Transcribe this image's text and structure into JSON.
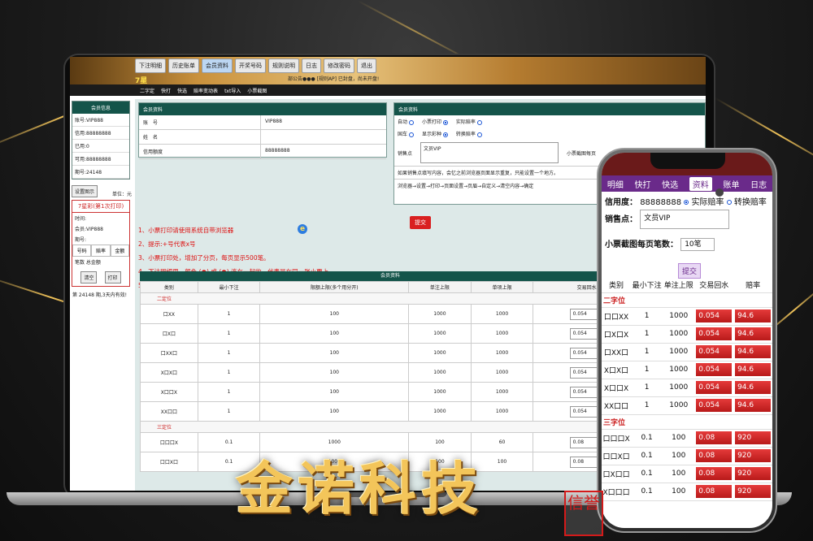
{
  "desktop": {
    "tabs": [
      "下注明细",
      "历史账单",
      "会员资料",
      "开奖号码",
      "规则说明",
      "日志",
      "修改密码",
      "退出"
    ],
    "active_tab": 2,
    "brand_mini": "7星",
    "notice": "部公告●●● [规则AP]       已封盘，尚未开盘!",
    "subnav": [
      "二字定",
      "快打",
      "快选",
      "赔率变动表",
      "txt导入",
      "小票截图"
    ],
    "left": {
      "info_title": "会员信息",
      "rows": [
        "账号:VIP888",
        "信用:88888888",
        "已用:0",
        "可用:88888888",
        "期号:24148"
      ],
      "settings_btn": "设置图示",
      "unit": "单位：元",
      "print_title": "7星彩(第1次打印)",
      "time_label": "时间:",
      "member": "会员:VIP888",
      "period": "期号:",
      "cols": [
        "号码",
        "赔率",
        "金额"
      ],
      "count": "笔数  总金额",
      "clear_btn": "清空",
      "print_btn": "打印",
      "valid": "第 24148 期,3天内有效!"
    },
    "member_card": {
      "title": "会员资料",
      "rows": [
        {
          "k": "账　号",
          "v": "VIP888"
        },
        {
          "k": "姓　名",
          "v": ""
        },
        {
          "k": "信用额度",
          "v": "88888888"
        }
      ]
    },
    "settings_card": {
      "title": "会员资料",
      "opt1": [
        "自动",
        "小票打印",
        "实际赔率"
      ],
      "opt2": [
        "国车",
        "显示彩种",
        "转换赔率"
      ],
      "sales_label": "销售点",
      "sales_value": "文员VIP",
      "screenshot_label": "小票截图每页",
      "rule1": "如果销售点填写内容，会忆之前浏览器页面显示重复，只能设置一个地方。",
      "rule2": "浏览器→设置→打印→页面设置→页眉→自定义→清空内容→确定"
    },
    "red_lines": [
      "1、小票打印请使用系统自带浏览器",
      "2、提示:+号代表x号",
      "3、小票打印处，增加了分页，每页显示500笔。",
      "4、下注明细里，颜色 (●) 或 (●) 连在一起的，代表是在同一张小票上。",
      "5、小票打印处内容超过500笔，再次下单后，系统会自动清空之前小票打印内容，请注意使用。"
    ],
    "submit": "提交",
    "table": {
      "title": "会员资料",
      "headers": [
        "类别",
        "最小下注",
        "限额上限(多个用分开)",
        "单注上限",
        "单项上限",
        "交易回水"
      ],
      "group1": "二定位",
      "rows1": [
        [
          "口XX",
          "1",
          "100",
          "1000",
          "1000",
          "0.054"
        ],
        [
          "口X口",
          "1",
          "100",
          "1000",
          "1000",
          "0.054"
        ],
        [
          "口XX口",
          "1",
          "100",
          "1000",
          "1000",
          "0.054"
        ],
        [
          "X口X口",
          "1",
          "100",
          "1000",
          "1000",
          "0.054"
        ],
        [
          "X口口X",
          "1",
          "100",
          "1000",
          "1000",
          "0.054"
        ],
        [
          "XX口口",
          "1",
          "100",
          "1000",
          "1000",
          "0.054"
        ]
      ],
      "group2": "三定位",
      "rows2": [
        [
          "口口口X",
          "0.1",
          "1000",
          "100",
          "60",
          "0.08"
        ],
        [
          "口口X口",
          "0.1",
          "1000",
          "100",
          "100",
          "0.08"
        ]
      ]
    }
  },
  "phone": {
    "nav": [
      "明细",
      "快打",
      "快选",
      "资料",
      "账单",
      "日志"
    ],
    "active_nav": 3,
    "credit_label": "信用度：",
    "credit_value": "88888888",
    "radio1": "实际赔率",
    "radio2": "转换赔率",
    "sales_label": "销售点：",
    "sales_value": "文员VIP",
    "shot_label": "小票截图每页笔数：",
    "shot_value": "10笔",
    "submit": "提交",
    "headers": [
      "类别",
      "最小下注",
      "单注上限",
      "交易回水",
      "赔率"
    ],
    "group1": "二字位",
    "rows1": [
      [
        "口口XX",
        "1",
        "1000",
        "0.054",
        "94.6"
      ],
      [
        "口X口X",
        "1",
        "1000",
        "0.054",
        "94.6"
      ],
      [
        "口XX口",
        "1",
        "1000",
        "0.054",
        "94.6"
      ],
      [
        "X口X口",
        "1",
        "1000",
        "0.054",
        "94.6"
      ],
      [
        "X口口X",
        "1",
        "1000",
        "0.054",
        "94.6"
      ],
      [
        "XX口口",
        "1",
        "1000",
        "0.054",
        "94.6"
      ]
    ],
    "group2": "三字位",
    "rows2": [
      [
        "口口口X",
        "0.1",
        "100",
        "0.08",
        "920"
      ],
      [
        "口口X口",
        "0.1",
        "100",
        "0.08",
        "920"
      ],
      [
        "口X口口",
        "0.1",
        "100",
        "0.08",
        "920"
      ],
      [
        "X口口口",
        "0.1",
        "100",
        "0.08",
        "920"
      ]
    ]
  },
  "brand": "金诺科技",
  "seal": "信誉"
}
